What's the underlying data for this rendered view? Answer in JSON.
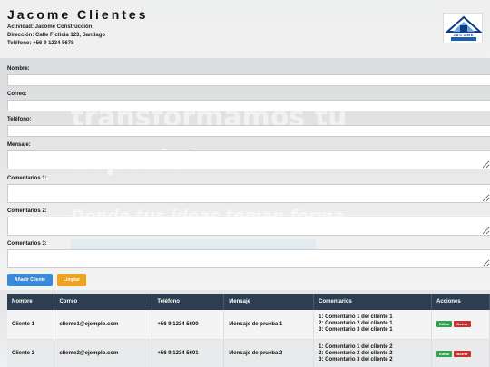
{
  "colors": {
    "header_bg": "#2c3e50",
    "primary": "#3a8ad8",
    "warning": "#f0a21c",
    "edit": "#2ea44f",
    "delete": "#c9302c"
  },
  "header": {
    "title": "Jacome Clientes",
    "actividad": "Actividad: Jacome Construcción",
    "direccion": "Dirección: Calle Ficticia 123, Santiago",
    "telefono": "Teléfono: +56 9 1234 5678",
    "logo_text": "JACOME"
  },
  "background": {
    "line1": "transformamos tu",
    "line2": "espacio!",
    "line3": "Donde tus ideas toman forma"
  },
  "form": {
    "nombre_label": "Nombre:",
    "correo_label": "Correo:",
    "telefono_label": "Teléfono:",
    "mensaje_label": "Mensaje:",
    "comentarios1_label": "Comentarios 1:",
    "comentarios2_label": "Comentarios 2:",
    "comentarios3_label": "Comentarios 3:",
    "add_button": "Añadir Cliente",
    "clear_button": "Limpiar"
  },
  "table": {
    "headers": [
      "Nombre",
      "Correo",
      "Teléfono",
      "Mensaje",
      "Comentarios",
      "Acciones"
    ],
    "rows": [
      {
        "nombre": "Cliente 1",
        "correo": "cliente1@ejemplo.com",
        "telefono": "+56 9 1234 5600",
        "mensaje": "Mensaje de prueba 1",
        "c1": "1: Comentario 1 del cliente 1",
        "c2": "2: Comentario 2 del cliente 1",
        "c3": "3: Comentario 3 del cliente 1",
        "edit": "Editar",
        "delete": "Borrar"
      },
      {
        "nombre": "Cliente 2",
        "correo": "cliente2@ejemplo.com",
        "telefono": "+56 9 1234 5601",
        "mensaje": "Mensaje de prueba 2",
        "c1": "1: Comentario 1 del cliente 2",
        "c2": "2: Comentario 2 del cliente 2",
        "c3": "3: Comentario 3 del cliente 2",
        "edit": "Editar",
        "delete": "Borrar"
      }
    ]
  }
}
